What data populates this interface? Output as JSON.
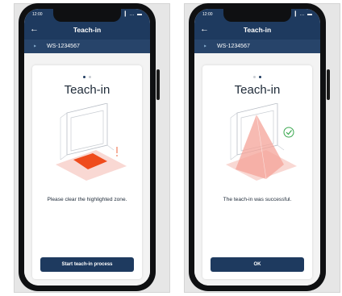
{
  "screens": [
    {
      "status_time": "12:00",
      "status_icons": "▎… ▬",
      "back_icon": "arrow-left-icon",
      "nav_title": "Teach-in",
      "device_id": "WS-1234567",
      "card_title": "Teach-in",
      "message": "Please clear the highlighted zone.",
      "button_label": "Start teach-in process",
      "active_step": 1
    },
    {
      "status_time": "12:00",
      "status_icons": "▎… ▬",
      "back_icon": "arrow-left-icon",
      "nav_title": "Teach-in",
      "device_id": "WS-1234567",
      "card_title": "Teach-in",
      "message": "The teach-in was successful.",
      "button_label": "OK",
      "active_step": 2
    }
  ],
  "colors": {
    "navy": "#1e3a5f",
    "device_bar": "#27446a",
    "zone_orange": "#ef4b1c",
    "zone_pink": "#f6c3bc",
    "success_green": "#3aa84f"
  }
}
